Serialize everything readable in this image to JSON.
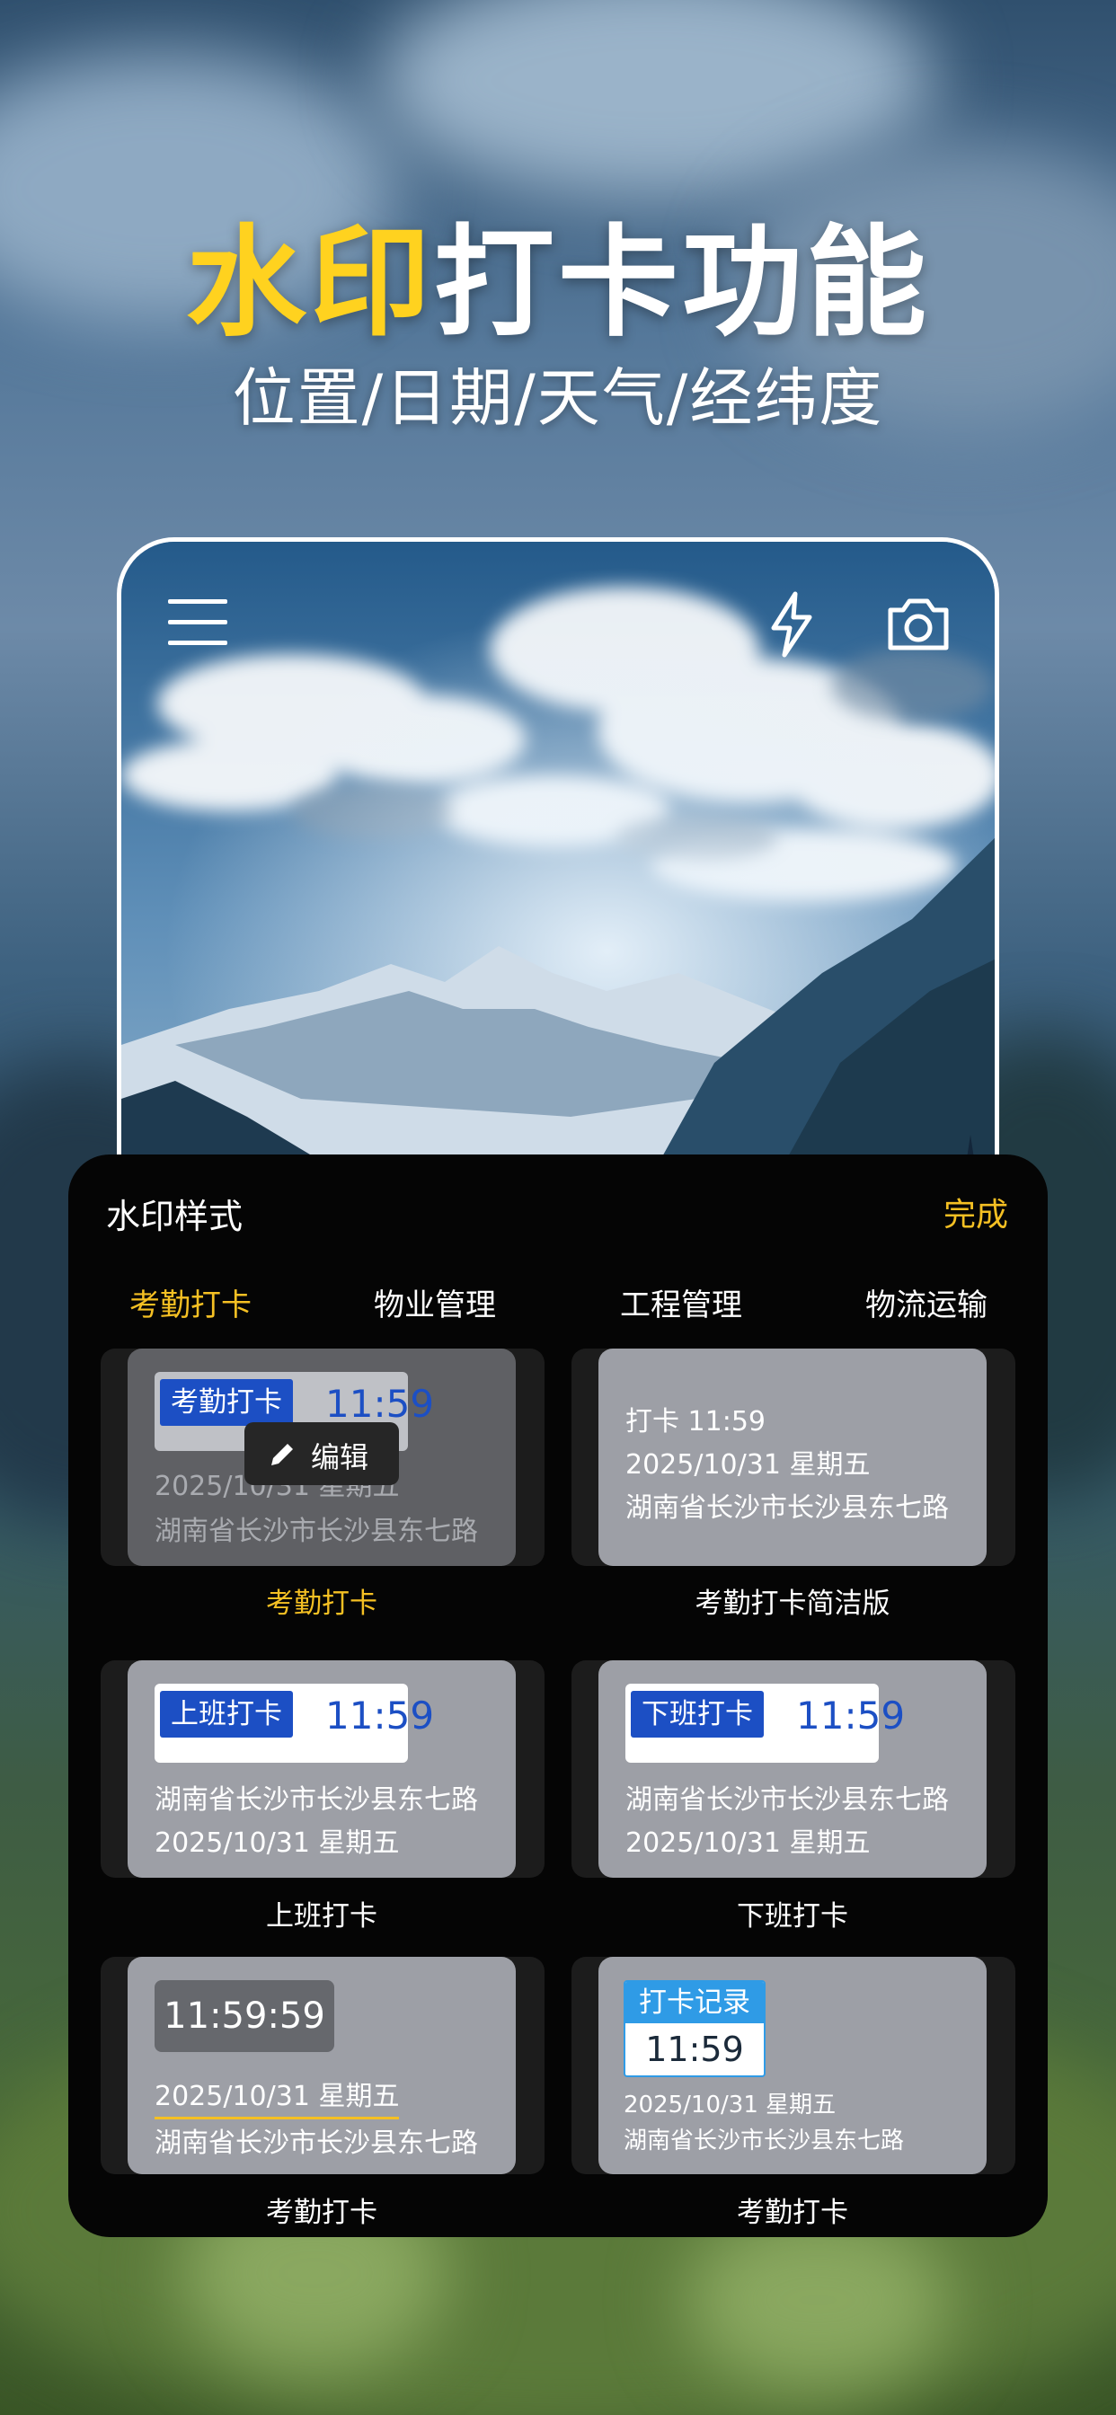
{
  "hero": {
    "title_highlight": "水印",
    "title_rest": "打卡功能",
    "subtitle": "位置/日期/天气/经纬度"
  },
  "camera": {
    "menu_icon": "menu-icon",
    "flash_icon": "flash-icon",
    "camera_icon": "camera-switch-icon"
  },
  "sheet": {
    "title": "水印样式",
    "done": "完成",
    "tabs": [
      {
        "label": "考勤打卡",
        "active": true
      },
      {
        "label": "物业管理",
        "active": false
      },
      {
        "label": "工程管理",
        "active": false
      },
      {
        "label": "物流运输",
        "active": false
      }
    ],
    "templates": [
      {
        "caption": "考勤打卡",
        "badge": "考勤打卡",
        "time": "11:59",
        "line1": "2025/10/31  星期五",
        "line2": "湖南省长沙市长沙县东七路",
        "edit_label": "编辑"
      },
      {
        "caption": "考勤打卡简洁版",
        "line1": "打卡 11:59",
        "line2": "2025/10/31  星期五",
        "line3": "湖南省长沙市长沙县东七路"
      },
      {
        "caption": "上班打卡",
        "badge": "上班打卡",
        "time": "11:59",
        "line1": "湖南省长沙市长沙县东七路",
        "line2": "2025/10/31  星期五"
      },
      {
        "caption": "下班打卡",
        "badge": "下班打卡",
        "time": "11:59",
        "line1": "湖南省长沙市长沙县东七路",
        "line2": "2025/10/31  星期五"
      },
      {
        "caption": "考勤打卡",
        "time": "11:59:59",
        "line1": "2025/10/31  星期五",
        "line2": "湖南省长沙市长沙县东七路"
      },
      {
        "caption": "考勤打卡",
        "badge": "打卡记录",
        "time": "11:59",
        "line1": "2025/10/31  星期五",
        "line2": "湖南省长沙市长沙县东七路"
      }
    ]
  }
}
